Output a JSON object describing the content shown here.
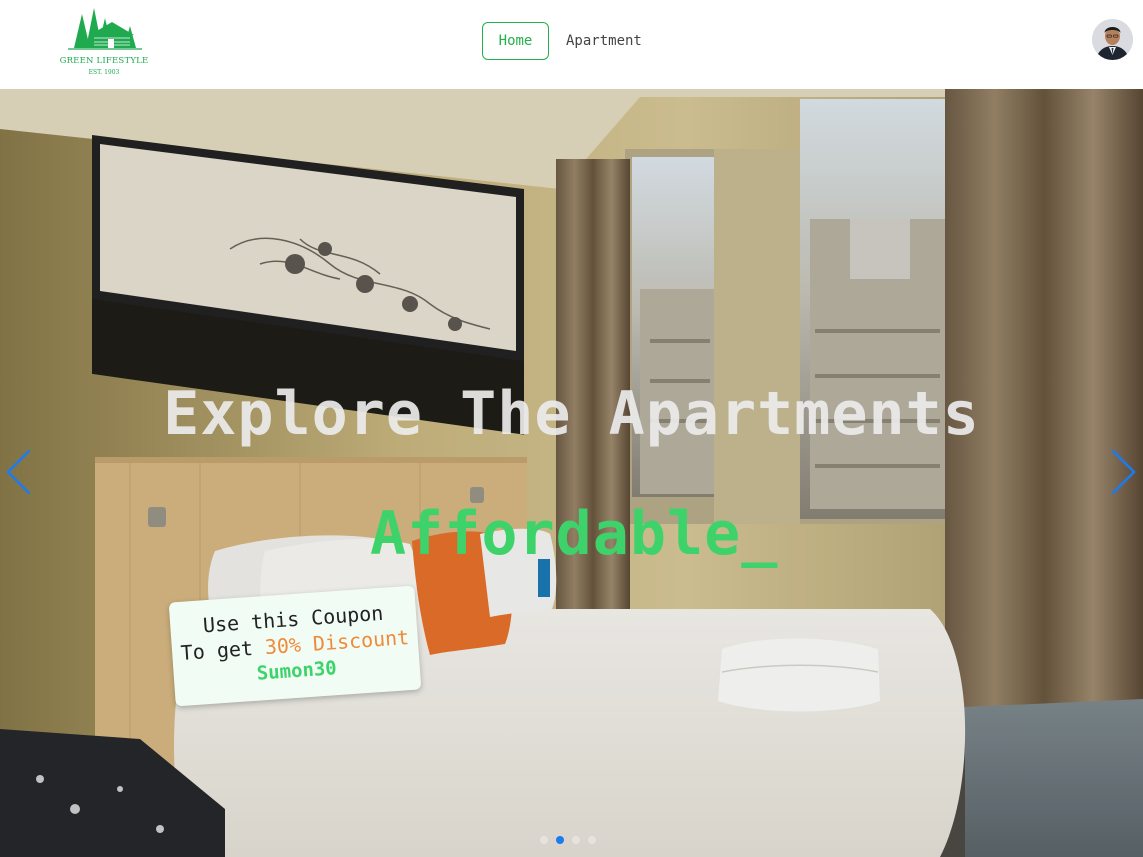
{
  "brand": {
    "name": "GREEN LIFESTYLE",
    "established": "EST. 1903",
    "logo_icon": "cabin-trees-icon",
    "color": "#1faa50"
  },
  "nav": {
    "links": [
      {
        "label": "Home",
        "active": true
      },
      {
        "label": "Apartment",
        "active": false
      }
    ],
    "accent": "#22b14c"
  },
  "user": {
    "avatar_icon": "user-avatar"
  },
  "hero": {
    "title": "Explore The Apartments",
    "typed_text": "Affordable_",
    "typed_color": "#3ed36a",
    "background": "hotel-bedroom-photo",
    "coupon": {
      "line1": "Use this Coupon",
      "line2_prefix": "To get ",
      "discount": "30% Discount",
      "code": "Sumon30"
    },
    "carousel": {
      "slides": 4,
      "active_index": 1,
      "prev_icon": "chevron-left-icon",
      "next_icon": "chevron-right-icon",
      "arrow_color": "#1a7cf0"
    }
  }
}
